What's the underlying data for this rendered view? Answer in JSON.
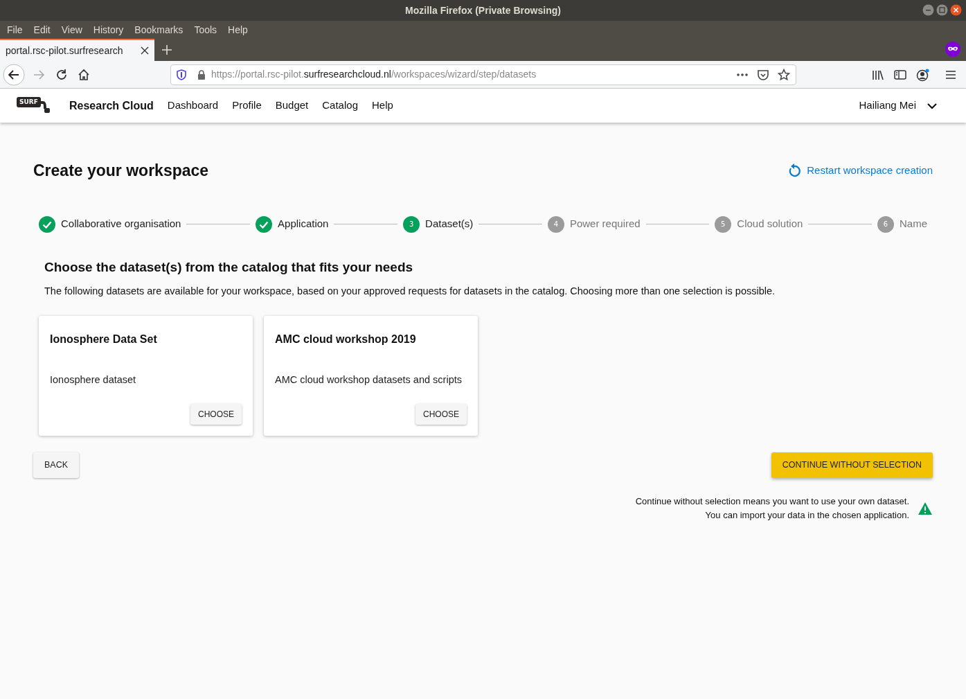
{
  "window": {
    "title": "Mozilla Firefox (Private Browsing)"
  },
  "menu_bar": [
    "File",
    "Edit",
    "View",
    "History",
    "Bookmarks",
    "Tools",
    "Help"
  ],
  "tabs": [
    {
      "label": "portal.rsc-pilot.surfresearch",
      "selected": true
    }
  ],
  "address_bar": {
    "prefix": "https://portal.rsc-pilot.",
    "domain": "surfresearchcloud.nl",
    "path": "/workspaces/wizard/step/datasets"
  },
  "site_nav": {
    "logo": "SURF",
    "brand": "Research Cloud",
    "links": [
      "Dashboard",
      "Profile",
      "Budget",
      "Catalog",
      "Help"
    ],
    "user": "Hailiang Mei"
  },
  "page": {
    "title": "Create your workspace",
    "restart_link": "Restart workspace creation"
  },
  "steps": [
    {
      "label": "Collaborative organisation",
      "kind": "done"
    },
    {
      "label": "Application",
      "kind": "done"
    },
    {
      "number": "3",
      "label": "Dataset(s)",
      "kind": "current"
    },
    {
      "number": "4",
      "label": "Power required",
      "kind": "pending"
    },
    {
      "number": "5",
      "label": "Cloud solution",
      "kind": "pending"
    },
    {
      "number": "6",
      "label": "Name",
      "kind": "pending"
    }
  ],
  "section": {
    "heading": "Choose the dataset(s) from the catalog that fits your needs",
    "description": "The following datasets are available for your workspace, based on your approved requests for datasets in the catalog. Choosing more than one selection is possible."
  },
  "datasets": [
    {
      "title": "Ionosphere Data Set",
      "description": "Ionosphere dataset",
      "button": "CHOOSE"
    },
    {
      "title": "AMC cloud workshop 2019",
      "description": "AMC cloud workshop datasets and scripts",
      "button": "CHOOSE"
    }
  ],
  "back_button": "BACK",
  "continue_button": "CONTINUE WITHOUT SELECTION",
  "notice": [
    "Continue without selection means you want to use your own dataset.",
    "You can import your data in the chosen application."
  ]
}
